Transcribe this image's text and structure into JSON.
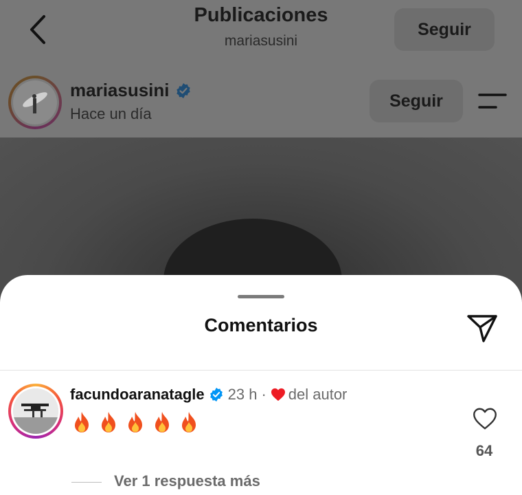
{
  "header": {
    "title": "Publicaciones",
    "subtitle": "mariasusini",
    "follow_label": "Seguir"
  },
  "post": {
    "username": "mariasusini",
    "time": "Hace un día",
    "follow_label": "Seguir",
    "verified": true
  },
  "comments_sheet": {
    "title": "Comentarios",
    "comment": {
      "username": "facundoaranatagle",
      "verified": true,
      "age": "23 h",
      "separator": "·",
      "author_like_label": "del autor",
      "text": "🔥🔥🔥🔥🔥",
      "like_count": "64",
      "replies_label": "Ver 1 respuesta más"
    }
  },
  "colors": {
    "verified_blue": "#0095f6",
    "heart_red": "#ed1c24",
    "sheet_bg": "#ffffff",
    "dim_overlay": "#787878"
  },
  "icons": [
    "back-chevron-icon",
    "verified-badge-icon",
    "menu-icon",
    "share-send-icon",
    "heart-icon",
    "fire-emoji-icon"
  ]
}
